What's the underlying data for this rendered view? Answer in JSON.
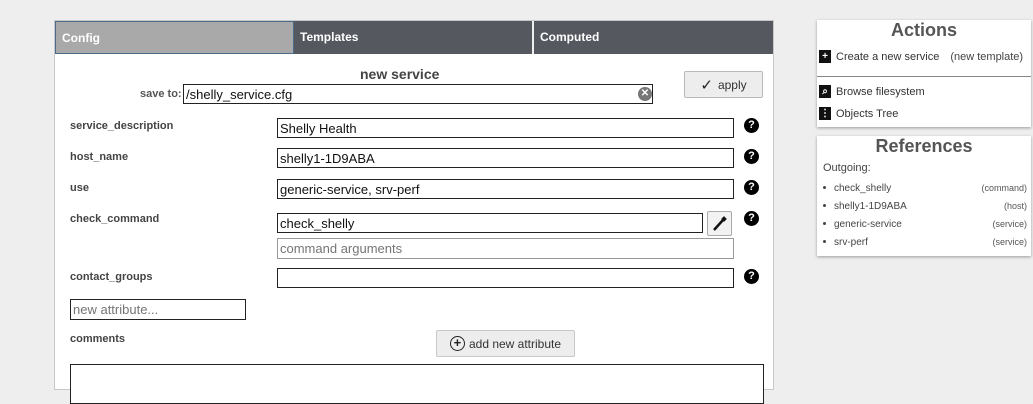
{
  "tabs": [
    {
      "label": "Config"
    },
    {
      "label": "Templates"
    },
    {
      "label": "Computed"
    }
  ],
  "form": {
    "title": "new service",
    "save_to_label": "save to:",
    "save_to_value": "/shelly_service.cfg",
    "apply_label": "apply",
    "attributes": [
      {
        "label": "service_description",
        "value": "Shelly Health"
      },
      {
        "label": "host_name",
        "value": "shelly1-1D9ABA"
      },
      {
        "label": "use",
        "value": "generic-service, srv-perf"
      },
      {
        "label": "check_command",
        "value": "check_shelly"
      },
      {
        "label": "contact_groups",
        "value": ""
      }
    ],
    "command_args_placeholder": "command arguments",
    "new_attribute_placeholder": "new attribute...",
    "add_attribute_label": "add new attribute",
    "comments_label": "comments"
  },
  "actions": {
    "title": "Actions",
    "items": [
      {
        "label": "Create a new service",
        "sub": "(new template)",
        "icon": "plus-file-icon"
      },
      {
        "label": "Browse filesystem",
        "icon": "folder-search-icon"
      },
      {
        "label": "Objects Tree",
        "icon": "folder-tree-icon"
      }
    ]
  },
  "references": {
    "title": "References",
    "outgoing_label": "Outgoing:",
    "items": [
      {
        "name": "check_shelly",
        "kind": "(command)"
      },
      {
        "name": "shelly1-1D9ABA",
        "kind": "(host)"
      },
      {
        "name": "generic-service",
        "kind": "(service)"
      },
      {
        "name": "srv-perf",
        "kind": "(service)"
      }
    ]
  },
  "colors": {
    "active_tab": "#a9a9a9",
    "inactive_tab": "#55595f",
    "page_bg": "#eeeeee"
  }
}
